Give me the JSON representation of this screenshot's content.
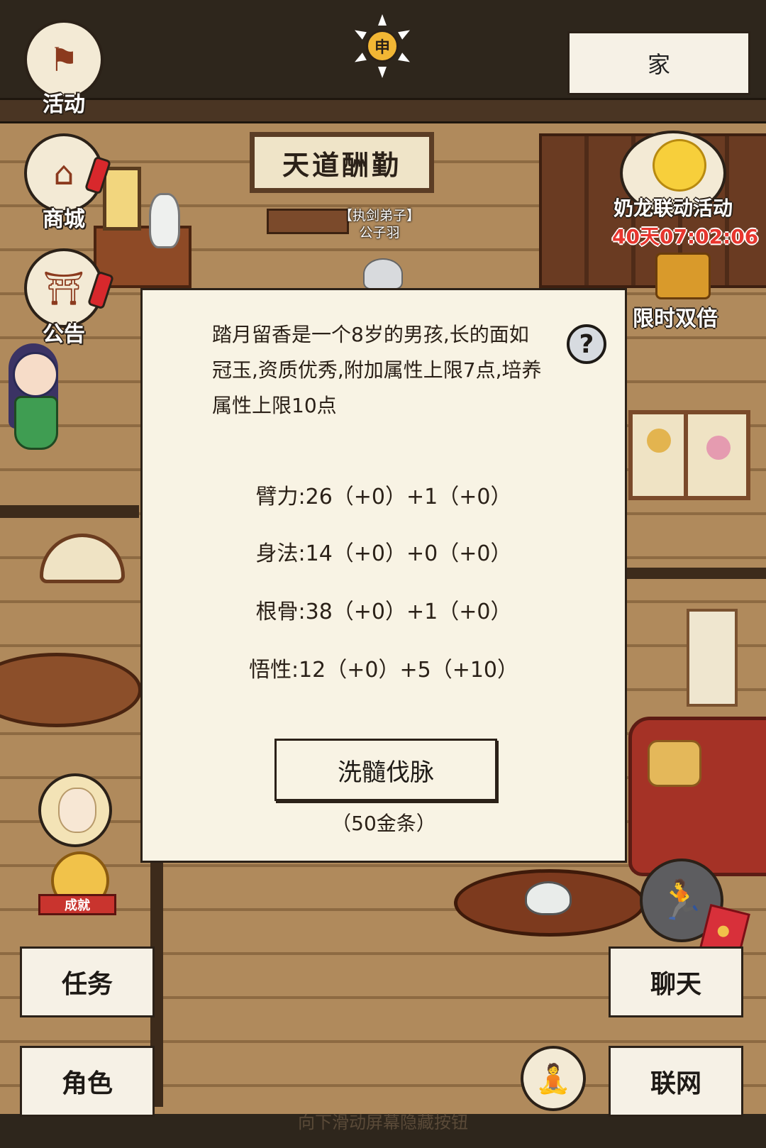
{
  "hud": {
    "activity_label": "活动",
    "shop_label": "商城",
    "notice_label": "公告",
    "time_glyph": "申",
    "home_label": "家",
    "event_title": "奶龙联动活动",
    "event_timer": "40天07:02:06",
    "double_label": "限时双倍",
    "achievement_label": "成就",
    "hint": "向下滑动屏幕隐藏按钮"
  },
  "scene": {
    "sign_text": "天道酬勤",
    "npc_title": "【执剑弟子】",
    "npc_name": "公子羽"
  },
  "left_buttons": {
    "task": "任务",
    "role": "角色"
  },
  "right_buttons": {
    "chat": "聊天",
    "network": "联网"
  },
  "modal": {
    "description": "踏月留香是一个8岁的男孩,长的面如冠玉,资质优秀,附加属性上限7点,培养属性上限10点",
    "help_glyph": "?",
    "stats": [
      {
        "text": "臂力:26（+0）+1（+0）"
      },
      {
        "text": "身法:14（+0）+0（+0）"
      },
      {
        "text": "根骨:38（+0）+1（+0）"
      },
      {
        "text": "悟性:12（+0）+5（+10）"
      }
    ],
    "refine_button": "洗髓伐脉",
    "cost": "（50金条）"
  },
  "icons": {
    "activity": "flag-icon",
    "shop": "shop-icon",
    "notice": "notice-board-icon",
    "run": "run-icon",
    "meditate": "meditate-icon",
    "help": "question-icon"
  },
  "colors": {
    "timer_red": "#e8362e",
    "panel_bg": "#f8f3e4",
    "outline": "#2b2118"
  }
}
